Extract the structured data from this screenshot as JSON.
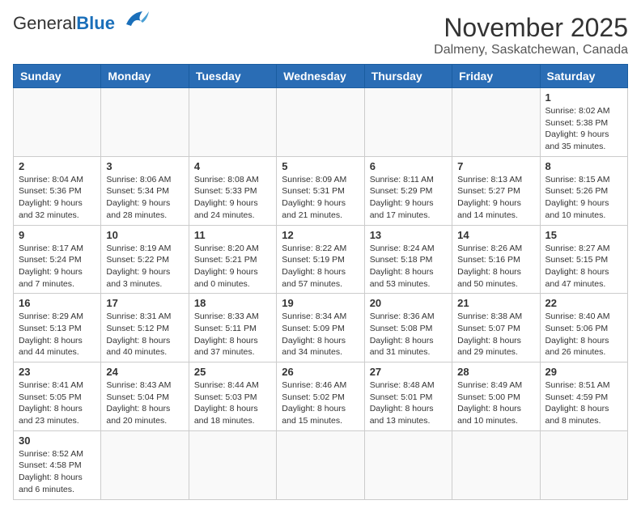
{
  "header": {
    "logo_text_general": "General",
    "logo_text_blue": "Blue",
    "month_title": "November 2025",
    "location": "Dalmeny, Saskatchewan, Canada"
  },
  "weekdays": [
    "Sunday",
    "Monday",
    "Tuesday",
    "Wednesday",
    "Thursday",
    "Friday",
    "Saturday"
  ],
  "weeks": [
    [
      {
        "day": "",
        "info": ""
      },
      {
        "day": "",
        "info": ""
      },
      {
        "day": "",
        "info": ""
      },
      {
        "day": "",
        "info": ""
      },
      {
        "day": "",
        "info": ""
      },
      {
        "day": "",
        "info": ""
      },
      {
        "day": "1",
        "info": "Sunrise: 8:02 AM\nSunset: 5:38 PM\nDaylight: 9 hours\nand 35 minutes."
      }
    ],
    [
      {
        "day": "2",
        "info": "Sunrise: 8:04 AM\nSunset: 5:36 PM\nDaylight: 9 hours\nand 32 minutes."
      },
      {
        "day": "3",
        "info": "Sunrise: 8:06 AM\nSunset: 5:34 PM\nDaylight: 9 hours\nand 28 minutes."
      },
      {
        "day": "4",
        "info": "Sunrise: 8:08 AM\nSunset: 5:33 PM\nDaylight: 9 hours\nand 24 minutes."
      },
      {
        "day": "5",
        "info": "Sunrise: 8:09 AM\nSunset: 5:31 PM\nDaylight: 9 hours\nand 21 minutes."
      },
      {
        "day": "6",
        "info": "Sunrise: 8:11 AM\nSunset: 5:29 PM\nDaylight: 9 hours\nand 17 minutes."
      },
      {
        "day": "7",
        "info": "Sunrise: 8:13 AM\nSunset: 5:27 PM\nDaylight: 9 hours\nand 14 minutes."
      },
      {
        "day": "8",
        "info": "Sunrise: 8:15 AM\nSunset: 5:26 PM\nDaylight: 9 hours\nand 10 minutes."
      }
    ],
    [
      {
        "day": "9",
        "info": "Sunrise: 8:17 AM\nSunset: 5:24 PM\nDaylight: 9 hours\nand 7 minutes."
      },
      {
        "day": "10",
        "info": "Sunrise: 8:19 AM\nSunset: 5:22 PM\nDaylight: 9 hours\nand 3 minutes."
      },
      {
        "day": "11",
        "info": "Sunrise: 8:20 AM\nSunset: 5:21 PM\nDaylight: 9 hours\nand 0 minutes."
      },
      {
        "day": "12",
        "info": "Sunrise: 8:22 AM\nSunset: 5:19 PM\nDaylight: 8 hours\nand 57 minutes."
      },
      {
        "day": "13",
        "info": "Sunrise: 8:24 AM\nSunset: 5:18 PM\nDaylight: 8 hours\nand 53 minutes."
      },
      {
        "day": "14",
        "info": "Sunrise: 8:26 AM\nSunset: 5:16 PM\nDaylight: 8 hours\nand 50 minutes."
      },
      {
        "day": "15",
        "info": "Sunrise: 8:27 AM\nSunset: 5:15 PM\nDaylight: 8 hours\nand 47 minutes."
      }
    ],
    [
      {
        "day": "16",
        "info": "Sunrise: 8:29 AM\nSunset: 5:13 PM\nDaylight: 8 hours\nand 44 minutes."
      },
      {
        "day": "17",
        "info": "Sunrise: 8:31 AM\nSunset: 5:12 PM\nDaylight: 8 hours\nand 40 minutes."
      },
      {
        "day": "18",
        "info": "Sunrise: 8:33 AM\nSunset: 5:11 PM\nDaylight: 8 hours\nand 37 minutes."
      },
      {
        "day": "19",
        "info": "Sunrise: 8:34 AM\nSunset: 5:09 PM\nDaylight: 8 hours\nand 34 minutes."
      },
      {
        "day": "20",
        "info": "Sunrise: 8:36 AM\nSunset: 5:08 PM\nDaylight: 8 hours\nand 31 minutes."
      },
      {
        "day": "21",
        "info": "Sunrise: 8:38 AM\nSunset: 5:07 PM\nDaylight: 8 hours\nand 29 minutes."
      },
      {
        "day": "22",
        "info": "Sunrise: 8:40 AM\nSunset: 5:06 PM\nDaylight: 8 hours\nand 26 minutes."
      }
    ],
    [
      {
        "day": "23",
        "info": "Sunrise: 8:41 AM\nSunset: 5:05 PM\nDaylight: 8 hours\nand 23 minutes."
      },
      {
        "day": "24",
        "info": "Sunrise: 8:43 AM\nSunset: 5:04 PM\nDaylight: 8 hours\nand 20 minutes."
      },
      {
        "day": "25",
        "info": "Sunrise: 8:44 AM\nSunset: 5:03 PM\nDaylight: 8 hours\nand 18 minutes."
      },
      {
        "day": "26",
        "info": "Sunrise: 8:46 AM\nSunset: 5:02 PM\nDaylight: 8 hours\nand 15 minutes."
      },
      {
        "day": "27",
        "info": "Sunrise: 8:48 AM\nSunset: 5:01 PM\nDaylight: 8 hours\nand 13 minutes."
      },
      {
        "day": "28",
        "info": "Sunrise: 8:49 AM\nSunset: 5:00 PM\nDaylight: 8 hours\nand 10 minutes."
      },
      {
        "day": "29",
        "info": "Sunrise: 8:51 AM\nSunset: 4:59 PM\nDaylight: 8 hours\nand 8 minutes."
      }
    ],
    [
      {
        "day": "30",
        "info": "Sunrise: 8:52 AM\nSunset: 4:58 PM\nDaylight: 8 hours\nand 6 minutes."
      },
      {
        "day": "",
        "info": ""
      },
      {
        "day": "",
        "info": ""
      },
      {
        "day": "",
        "info": ""
      },
      {
        "day": "",
        "info": ""
      },
      {
        "day": "",
        "info": ""
      },
      {
        "day": "",
        "info": ""
      }
    ]
  ]
}
